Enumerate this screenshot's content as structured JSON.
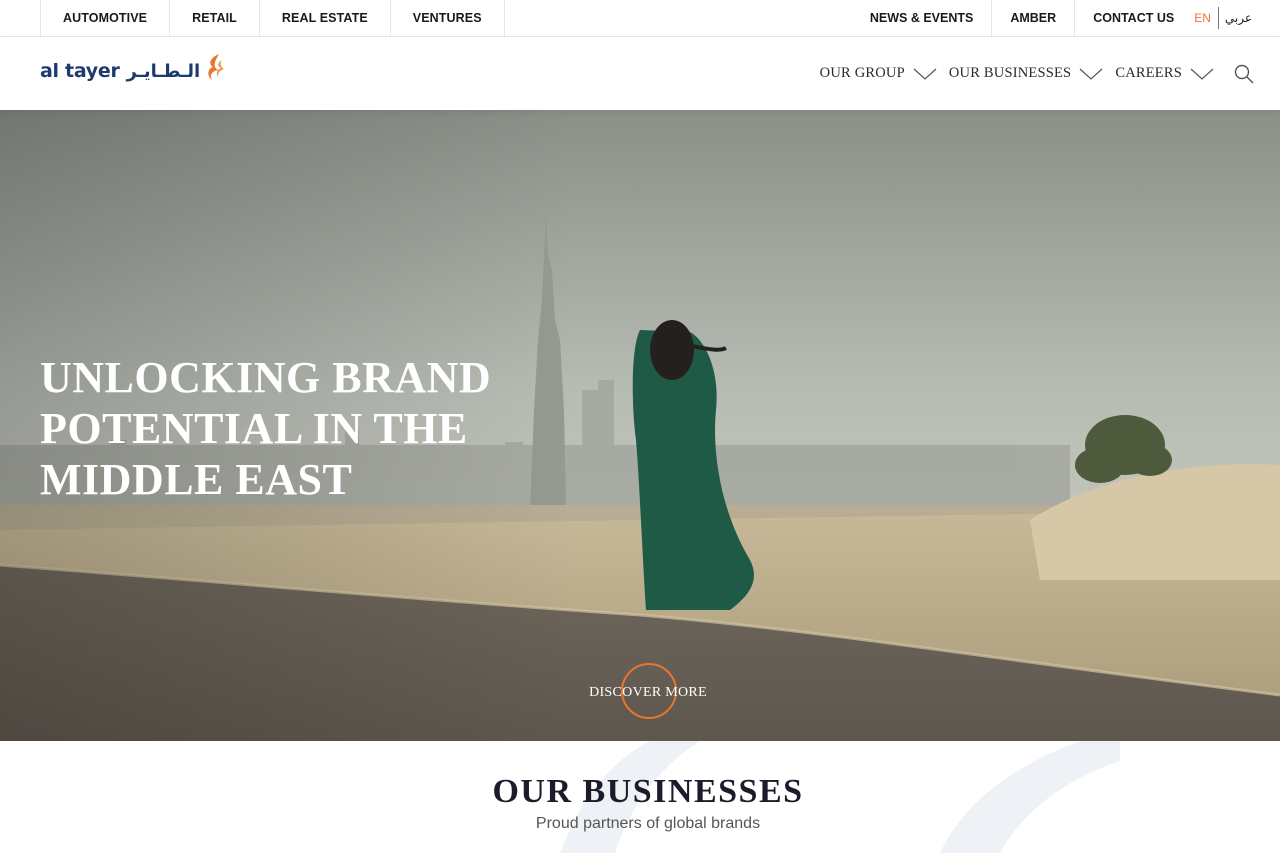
{
  "topbar": {
    "left_links": [
      "AUTOMOTIVE",
      "RETAIL",
      "REAL ESTATE",
      "VENTURES"
    ],
    "right_links": [
      "NEWS & EVENTS",
      "AMBER",
      "CONTACT US"
    ],
    "lang_active": "EN",
    "lang_alt": "عربي"
  },
  "header": {
    "logo_en": "al tayer",
    "logo_ar": "الـطـايـر",
    "nav": [
      {
        "label": "OUR GROUP",
        "icon": "chevron-down-icon"
      },
      {
        "label": "OUR BUSINESSES",
        "icon": "chevron-down-icon"
      },
      {
        "label": "CAREERS",
        "icon": "chevron-down-icon"
      }
    ],
    "search_icon": "search-icon"
  },
  "hero": {
    "title_lines": [
      "UNLOCKING BRAND",
      "POTENTIAL IN THE",
      "MIDDLE EAST"
    ],
    "cta": "DISCOVER MORE"
  },
  "businesses": {
    "title": "OUR BUSINESSES",
    "subtitle": "Proud partners of global brands"
  },
  "colors": {
    "accent": "#e8772e",
    "brand_navy": "#1f3a70",
    "text": "#1a1a1a"
  }
}
